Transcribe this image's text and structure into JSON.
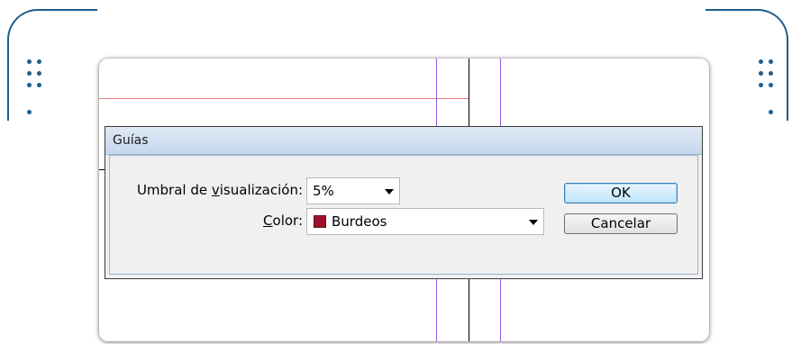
{
  "dialog": {
    "title": "Guías",
    "threshold": {
      "label_pre": "Umbral de ",
      "label_mnemonic": "v",
      "label_post": "isualización:",
      "value": "5%"
    },
    "color": {
      "label_mnemonic": "C",
      "label_post": "olor:",
      "value": "Burdeos",
      "swatch_color": "#a0102c"
    },
    "buttons": {
      "ok": "OK",
      "cancel": "Cancelar"
    }
  },
  "colors": {
    "frame": "#1f5d8c",
    "guide_red": "#f27a7a",
    "guide_purple": "#9b59e8",
    "guide_black": "#000000"
  }
}
